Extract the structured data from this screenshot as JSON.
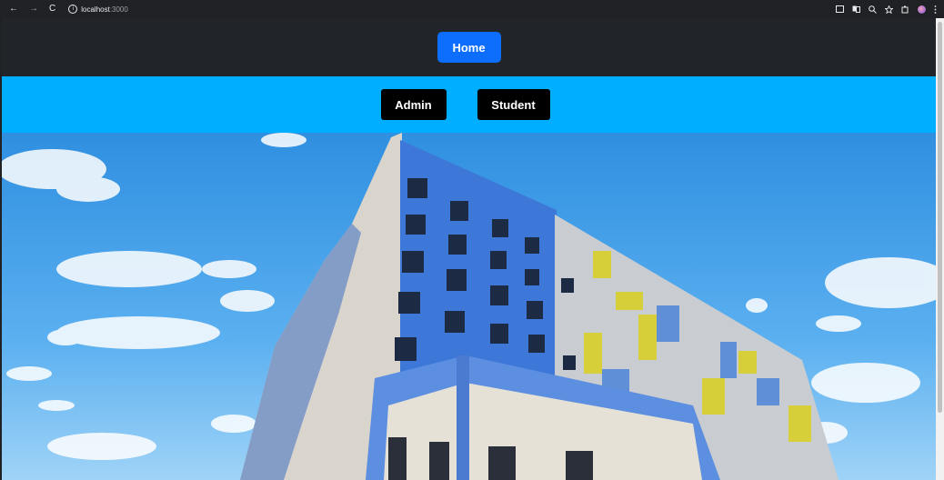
{
  "browser": {
    "host": "localhost",
    "port": ":3000",
    "back_icon": "←",
    "forward_icon": "→",
    "reload_icon": "C",
    "info_icon": "i"
  },
  "nav": {
    "home_label": "Home"
  },
  "roles": {
    "admin_label": "Admin",
    "student_label": "Student"
  },
  "colors": {
    "topbar": "#212529",
    "home_button": "#0d6efd",
    "rolebar": "#00aeff",
    "role_button": "#000000"
  },
  "hero": {
    "image_alt": "college building"
  }
}
